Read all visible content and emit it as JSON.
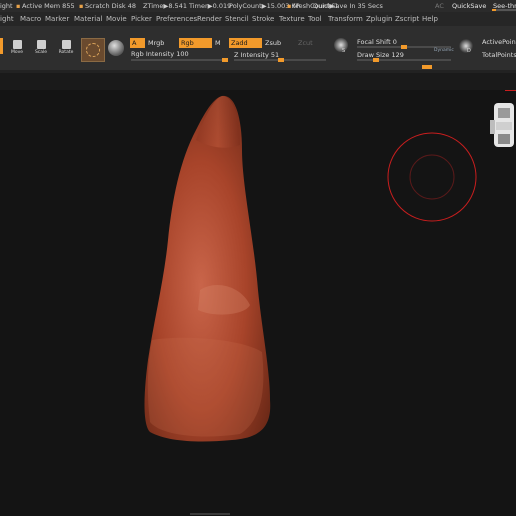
{
  "status": {
    "light": "ight",
    "active_mem": "Active Mem 855",
    "scratch_disk": "Scratch Disk 48",
    "ztime": "ZTime▶8.541 Timer▶0.019",
    "polycount": "PolyCount▶15.003 KP",
    "meshcount": "MeshCount▶1",
    "quicksave_timer": "QuickSave In 35 Secs",
    "ac": "AC",
    "quicksave_button": "QuickSave",
    "see_through": "See-thr"
  },
  "menu": {
    "items": [
      "ight",
      "Macro",
      "Marker",
      "Material",
      "Movie",
      "Picker",
      "Preferences",
      "Render",
      "Stencil",
      "Stroke",
      "Texture",
      "Tool",
      "Transform",
      "Zplugin",
      "Zscript",
      "Help"
    ]
  },
  "toolbar": {
    "move_label": "Move",
    "scale_label": "Scale",
    "rotate_label": "Rotate",
    "a_label": "A",
    "mrgb_label": "Mrgb",
    "rgb_label": "Rgb",
    "m_label": "M",
    "zadd_label": "Zadd",
    "zsub_label": "Zsub",
    "zcut_label": "Zcut",
    "rgb_intensity": "Rgb Intensity 100",
    "z_intensity_label": "Z Intensity",
    "z_intensity_value": "51",
    "focal_shift_label": "Focal Shift",
    "focal_shift_value": "0",
    "draw_size_label": "Draw Size",
    "draw_size_value": "129",
    "dynamic_label": "Dynamic",
    "active_points": "ActivePoints",
    "total_points": "TotalPoints",
    "s_label": "S",
    "d_label": "D"
  },
  "sliders": {
    "rgb_intensity": 1.0,
    "z_intensity": 0.51,
    "focal_shift": 0.5,
    "draw_size": 0.2
  },
  "colors": {
    "accent": "#f29a2b",
    "model": "#b44a2c",
    "brush_cursor": "#c81e1e"
  }
}
